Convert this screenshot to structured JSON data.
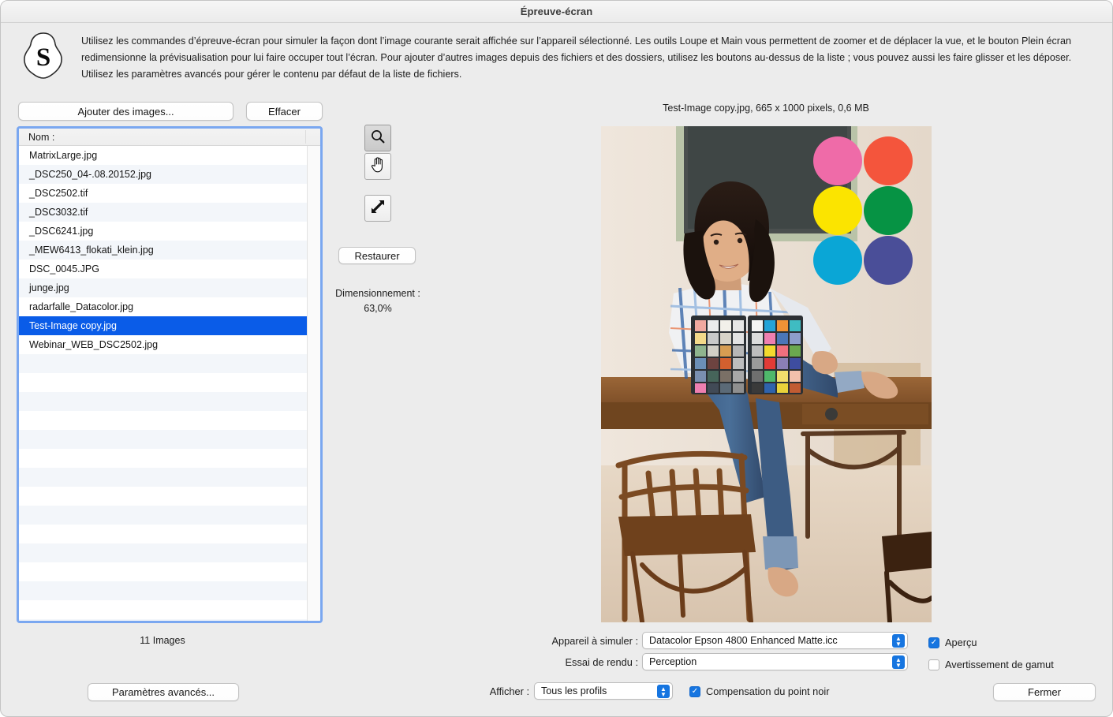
{
  "window": {
    "title": "Épreuve-écran"
  },
  "header": {
    "logo_letter": "S",
    "description": "Utilisez les commandes d’épreuve-écran pour simuler la façon dont l’image courante serait affichée sur l’appareil sélectionné. Les outils Loupe et Main vous permettent de zoomer et de déplacer la vue, et le bouton Plein écran redimensionne la prévisualisation pour lui faire occuper tout l’écran. Pour ajouter d’autres images depuis des fichiers et des dossiers, utilisez les boutons au-dessus de la liste ; vous pouvez aussi les faire glisser et les déposer. Utilisez les paramètres avancés pour gérer le contenu par défaut de la liste de fichiers."
  },
  "file_panel": {
    "add_images_label": "Ajouter des images...",
    "clear_label": "Effacer",
    "column_header": "Nom :",
    "files": [
      {
        "name": "MatrixLarge.jpg",
        "selected": false
      },
      {
        "name": "_DSC250_04-.08.20152.jpg",
        "selected": false
      },
      {
        "name": "_DSC2502.tif",
        "selected": false
      },
      {
        "name": "_DSC3032.tif",
        "selected": false
      },
      {
        "name": "_DSC6241.jpg",
        "selected": false
      },
      {
        "name": "_MEW6413_flokati_klein.jpg",
        "selected": false
      },
      {
        "name": "DSC_0045.JPG",
        "selected": false
      },
      {
        "name": "junge.jpg",
        "selected": false
      },
      {
        "name": "radarfalle_Datacolor.jpg",
        "selected": false
      },
      {
        "name": "Test-Image copy.jpg",
        "selected": true
      },
      {
        "name": "Webinar_WEB_DSC2502.jpg",
        "selected": false
      }
    ],
    "empty_row_count": 15,
    "count_label": "11 Images",
    "advanced_label": "Paramètres avancés..."
  },
  "tools": {
    "zoom_icon": "magnifier-icon",
    "hand_icon": "hand-icon",
    "fullscreen_icon": "fullscreen-arrows-icon",
    "active_tool": "zoom",
    "restore_label": "Restaurer",
    "scaling_label": "Dimensionnement :",
    "scaling_value": "63,0%"
  },
  "preview": {
    "info": "Test-Image copy.jpg, 665 x 1000 pixels, 0,6 MB",
    "dot_colors": [
      "#ef6ba8",
      "#f4553c",
      "#fbe400",
      "#069344",
      "#0aa6d6",
      "#4a4e98"
    ]
  },
  "settings": {
    "device_label": "Appareil à simuler :",
    "device_value": "Datacolor Epson 4800 Enhanced Matte.icc",
    "intent_label": "Essai de rendu :",
    "intent_value": "Perception",
    "show_label": "Afficher :",
    "show_value": "Tous les profils",
    "preview_checkbox": {
      "label": "Aperçu",
      "checked": true
    },
    "gamut_checkbox": {
      "label": "Avertissement de gamut",
      "checked": false
    },
    "bpc_checkbox": {
      "label": "Compensation du point noir",
      "checked": true
    },
    "close_label": "Fermer",
    "accent_color": "#1675e0",
    "selection_color": "#0a5ce8"
  }
}
